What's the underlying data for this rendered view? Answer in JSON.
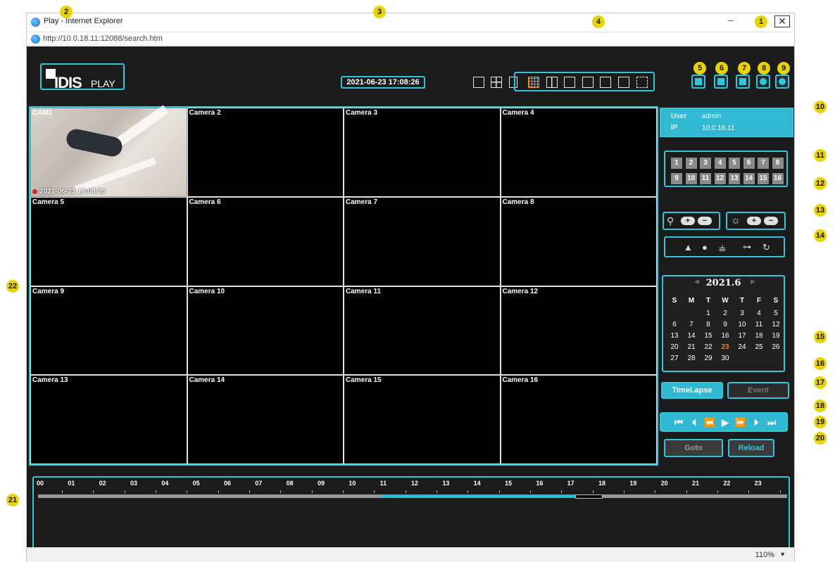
{
  "browser": {
    "title": "Play - Internet Explorer",
    "url": "http://10.0.18.11:12088/search.htm",
    "zoom": "110%"
  },
  "app": {
    "logo": "IDIS",
    "logo_sub": "PLAY",
    "datetime": "2021-06-23 17:08:26"
  },
  "user_info": {
    "user_label": "User",
    "user_value": "admin",
    "ip_label": "IP",
    "ip_value": "10.0.18.11"
  },
  "cameras": [
    "CAM1",
    "Camera 2",
    "Camera 3",
    "Camera 4",
    "Camera 5",
    "Camera 6",
    "Camera 7",
    "Camera 8",
    "Camera 9",
    "Camera 10",
    "Camera 11",
    "Camera 12",
    "Camera 13",
    "Camera 14",
    "Camera 15",
    "Camera 16"
  ],
  "cam1_timestamp": "2021-06-23 17:08:26",
  "channels": [
    "1",
    "2",
    "3",
    "4",
    "5",
    "6",
    "7",
    "8",
    "9",
    "10",
    "11",
    "12",
    "13",
    "14",
    "15",
    "16"
  ],
  "zoom_controls": {
    "plus": "+",
    "minus": "−"
  },
  "brightness_controls": {
    "plus": "+",
    "minus": "−"
  },
  "calendar": {
    "title": "2021.6",
    "dow": [
      "S",
      "M",
      "T",
      "W",
      "T",
      "F",
      "S"
    ],
    "weeks": [
      [
        "",
        "",
        "1",
        "2",
        "3",
        "4",
        "5"
      ],
      [
        "6",
        "7",
        "8",
        "9",
        "10",
        "11",
        "12"
      ],
      [
        "13",
        "14",
        "15",
        "16",
        "17",
        "18",
        "19"
      ],
      [
        "20",
        "21",
        "22",
        "23",
        "24",
        "25",
        "26"
      ],
      [
        "27",
        "28",
        "29",
        "30",
        "",
        "",
        ""
      ]
    ],
    "today": "23"
  },
  "mode_buttons": {
    "timelapse": "TimeLapse",
    "event": "Event"
  },
  "action_buttons": {
    "goto": "Goto",
    "reload": "Reload"
  },
  "timeline": {
    "hours": [
      "00",
      "01",
      "02",
      "03",
      "04",
      "05",
      "06",
      "07",
      "08",
      "09",
      "10",
      "11",
      "12",
      "13",
      "14",
      "15",
      "16",
      "17",
      "18",
      "19",
      "20",
      "21",
      "22",
      "23"
    ],
    "recorded_start_hour": 11,
    "recorded_end_hour": 17.2,
    "cursor_start_hour": 17.2,
    "cursor_end_hour": 18.1
  },
  "callouts": [
    "1",
    "2",
    "3",
    "4",
    "5",
    "6",
    "7",
    "8",
    "9",
    "10",
    "11",
    "12",
    "13",
    "14",
    "15",
    "16",
    "17",
    "18",
    "19",
    "20",
    "21",
    "22"
  ],
  "colors": {
    "accent": "#2fc6e0",
    "callout": "#e8d400",
    "today": "#f08a1c"
  }
}
